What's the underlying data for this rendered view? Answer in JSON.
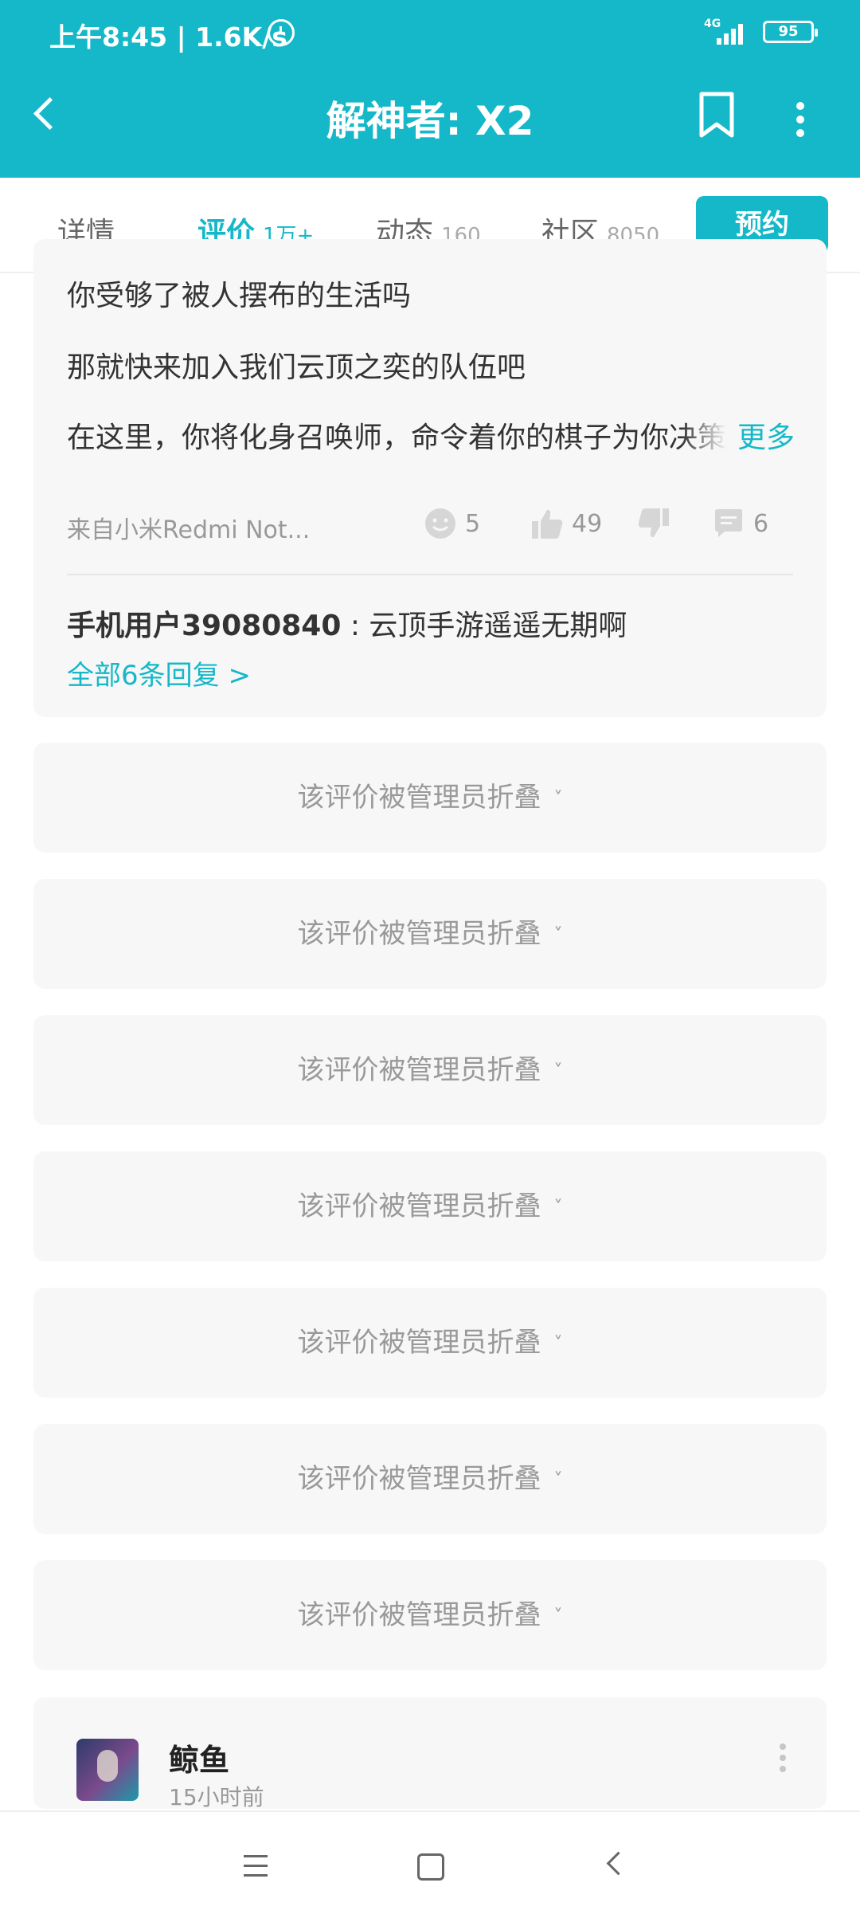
{
  "status_bar": {
    "time": "上午8:45 | 1.6K/s",
    "network": "4G",
    "battery": "95"
  },
  "app_bar": {
    "title": "解神者: X2"
  },
  "tabs": [
    {
      "label": "详情",
      "count": ""
    },
    {
      "label": "评价",
      "count": "1万+"
    },
    {
      "label": "动态",
      "count": "160"
    },
    {
      "label": "社区",
      "count": "8050"
    }
  ],
  "reserve_label": "预约",
  "review": {
    "lines": [
      "你受够了被人摆布的生活吗",
      "那就快来加入我们云顶之奕的队伍吧",
      "在这里，你将化身召唤师，命令着你的棋子为你决策"
    ],
    "more_label": "更多",
    "device": "来自小米Redmi Not...",
    "emoji_count": "5",
    "like_count": "49",
    "comment_count": "6",
    "reply": {
      "user": "手机用户39080840",
      "text": " : 云顶手游遥遥无期啊"
    },
    "all_replies_label": "全部6条回复 >"
  },
  "folded_label": "该评价被管理员折叠",
  "folded_chevron": "˅",
  "next_review": {
    "username": "鲸鱼",
    "time": "15小时前"
  },
  "colors": {
    "accent": "#15b8c8"
  }
}
